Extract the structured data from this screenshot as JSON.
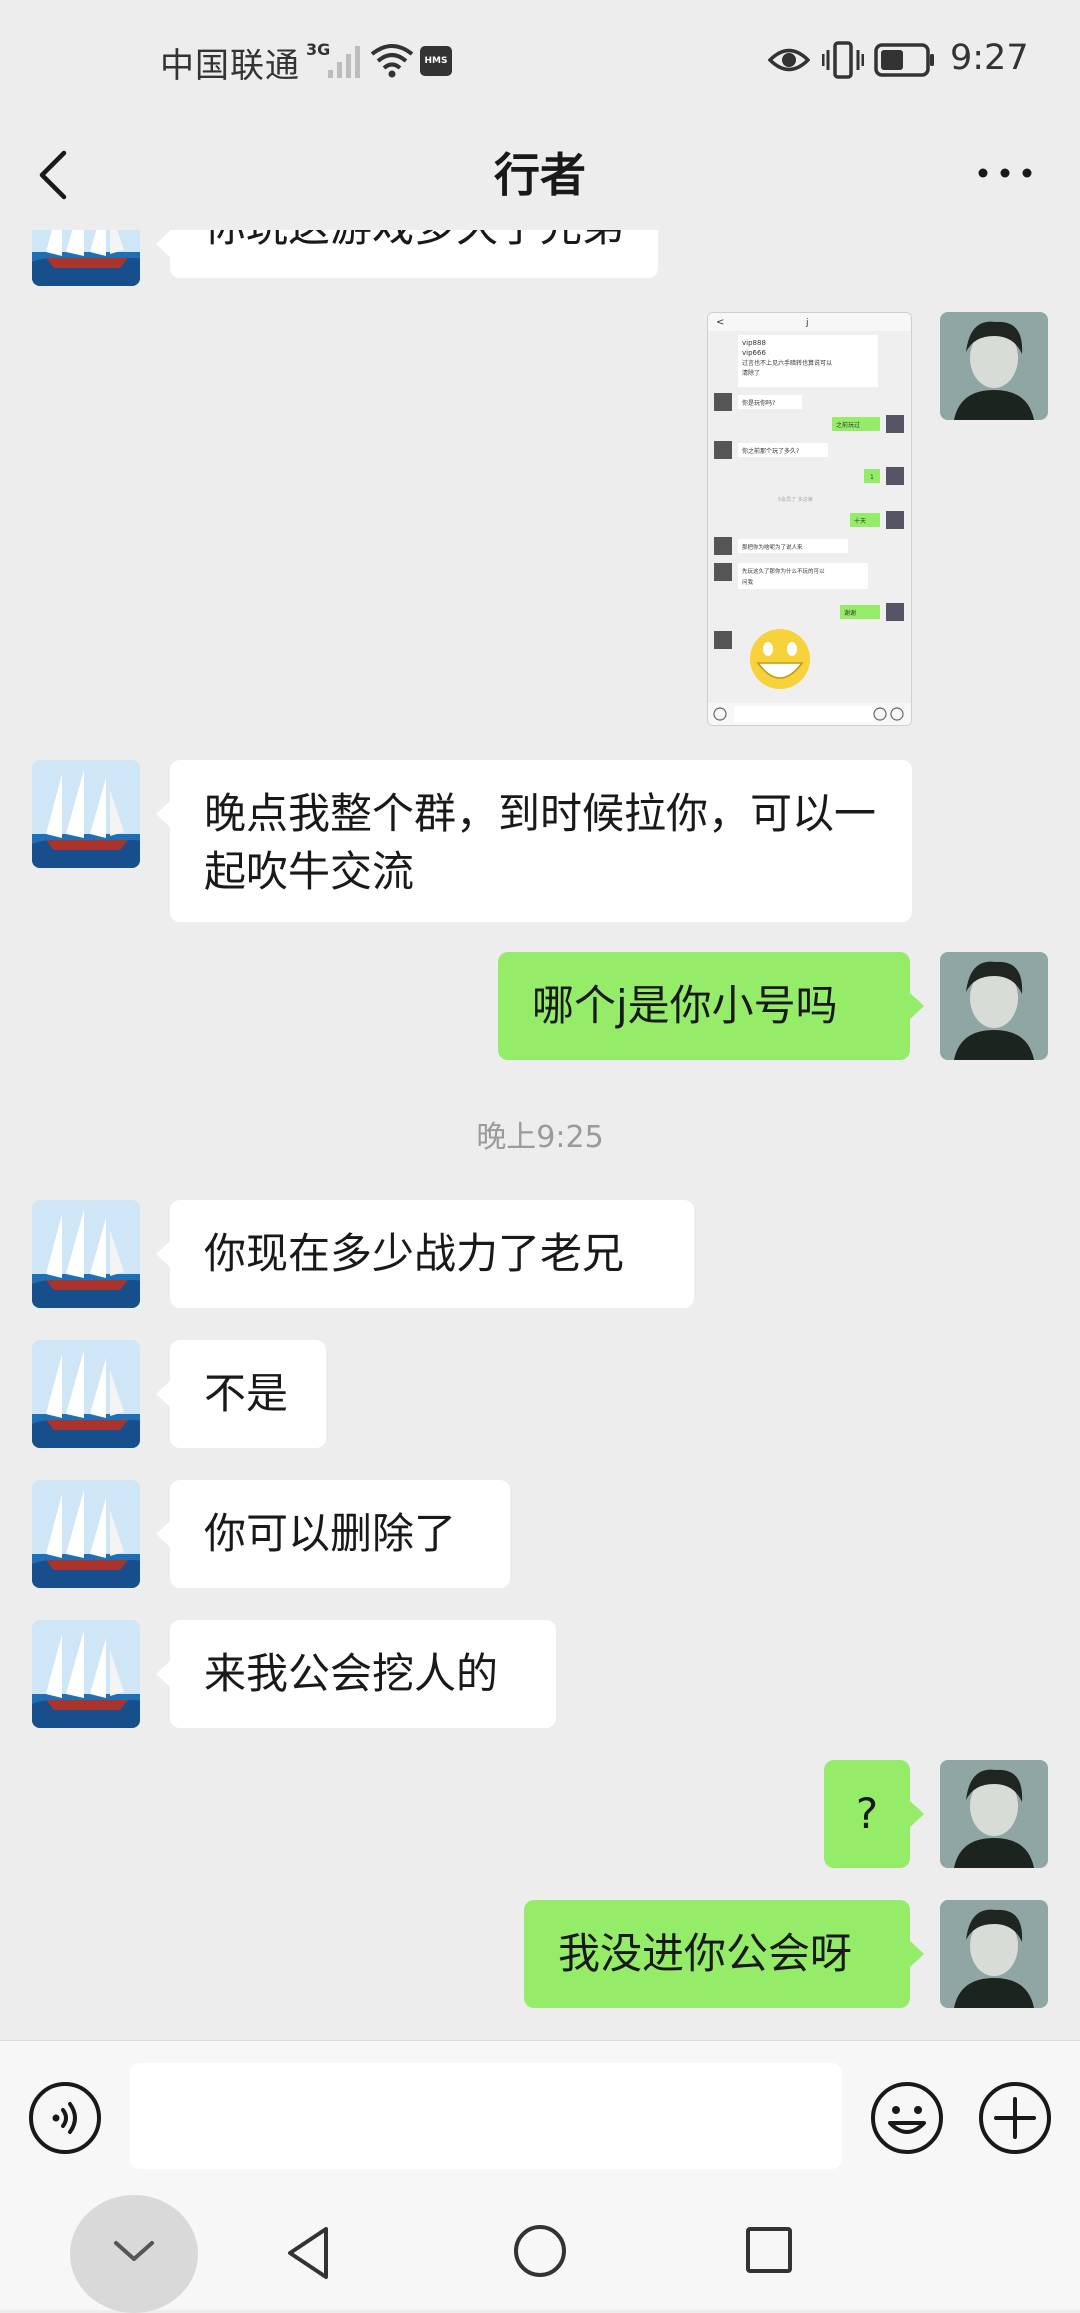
{
  "status_bar": {
    "carrier": "中国联通",
    "network_type": "3G",
    "hms_label": "HMS",
    "time": "9:27"
  },
  "header": {
    "title": "行者"
  },
  "messages": {
    "partial_top_text": "你玩这游戏多久了兄弟",
    "msg1": "晚点我整个群，到时候拉你，可以一起吹牛交流",
    "msg2": "哪个j是你小号吗",
    "timestamp": "晚上9:25",
    "msg3": "你现在多少战力了老兄",
    "msg4": "不是",
    "msg5": "你可以删除了",
    "msg6": "来我公会挖人的",
    "msg7": "?",
    "msg8": "我没进你公会呀"
  },
  "screenshot_thumb": {
    "title": "j",
    "lines": [
      "vip888",
      "vip666",
      "过言也不上见六手暗转也算说可以",
      "清除了",
      "你是玩你吗?",
      "之前玩过",
      "你之前那个玩了多久?",
      "1",
      "5会员了   多这第",
      "十天",
      "那把你为啥呢为了说人来",
      "先玩这久了那你为什么不玩的可以",
      "问我",
      "谢谢"
    ]
  },
  "input": {
    "value": "",
    "placeholder": ""
  },
  "colors": {
    "background": "#ededed",
    "bubble_out": "#95ec69",
    "bubble_in": "#ffffff"
  },
  "icons": {
    "back": "chevron-left-icon",
    "more": "more-dots-icon",
    "voice": "voice-icon",
    "emoji": "emoji-icon",
    "plus": "plus-icon"
  }
}
